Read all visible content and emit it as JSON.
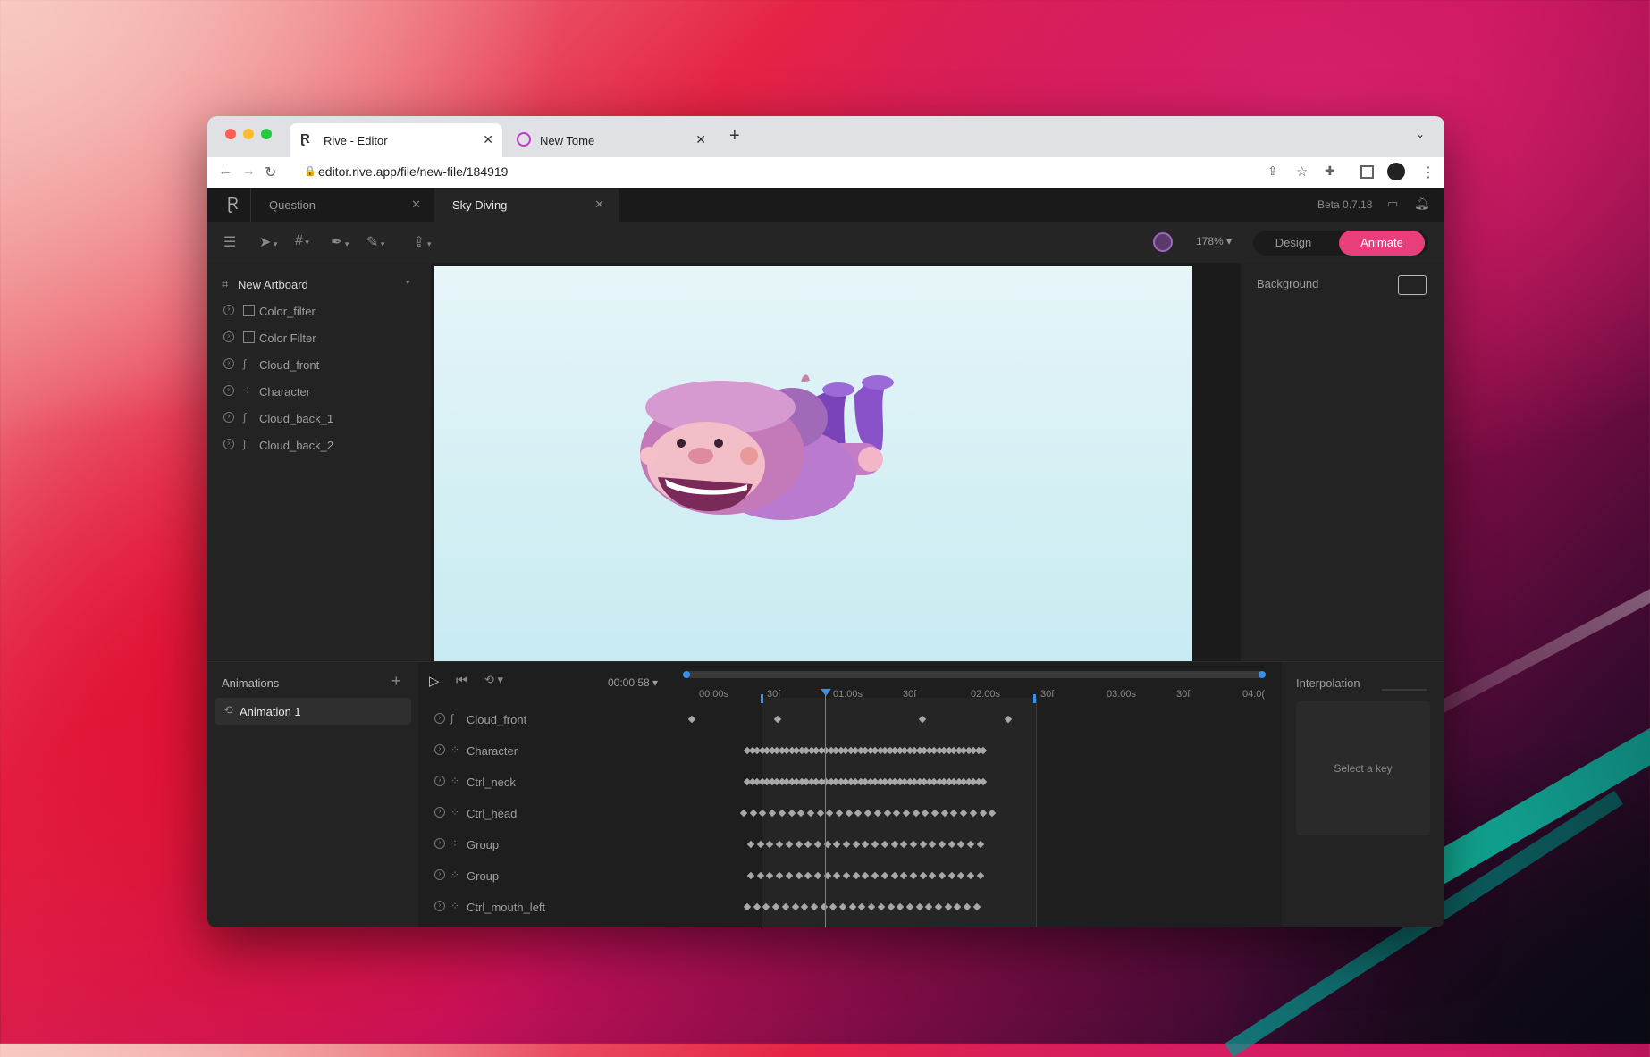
{
  "browser": {
    "tabs": [
      {
        "title": "Rive - Editor",
        "active": true
      },
      {
        "title": "New Tome",
        "active": false
      }
    ],
    "url": "editor.rive.app/file/new-file/184919"
  },
  "app": {
    "file_tabs": [
      {
        "label": "Question",
        "active": false
      },
      {
        "label": "Sky Diving",
        "active": true
      }
    ],
    "version": "Beta 0.7.18",
    "zoom": "178%",
    "mode_design": "Design",
    "mode_animate": "Animate"
  },
  "hierarchy": {
    "artboard": "New Artboard",
    "items": [
      {
        "name": "Color_filter",
        "icon": "square-icon"
      },
      {
        "name": "Color Filter",
        "icon": "square-icon"
      },
      {
        "name": "Cloud_front",
        "icon": "path-icon"
      },
      {
        "name": "Character",
        "icon": "group-icon"
      },
      {
        "name": "Cloud_back_1",
        "icon": "path-icon"
      },
      {
        "name": "Cloud_back_2",
        "icon": "path-icon"
      }
    ]
  },
  "properties": {
    "background_label": "Background"
  },
  "animations": {
    "title": "Animations",
    "items": [
      {
        "name": "Animation 1"
      }
    ]
  },
  "timeline": {
    "time": "00:00:58",
    "ticks": [
      "00:00s",
      "30f",
      "01:00s",
      "30f",
      "02:00s",
      "30f",
      "03:00s",
      "30f",
      "04:0("
    ],
    "rows": [
      {
        "name": "Cloud_front",
        "icon": "path-icon"
      },
      {
        "name": "Character",
        "icon": "group-icon"
      },
      {
        "name": "Ctrl_neck",
        "icon": "group-icon"
      },
      {
        "name": "Ctrl_head",
        "icon": "group-icon"
      },
      {
        "name": "Group",
        "icon": "group-icon"
      },
      {
        "name": "Group",
        "icon": "group-icon"
      },
      {
        "name": "Ctrl_mouth_left",
        "icon": "group-icon"
      }
    ]
  },
  "interpolation": {
    "title": "Interpolation",
    "empty": "Select a key"
  }
}
